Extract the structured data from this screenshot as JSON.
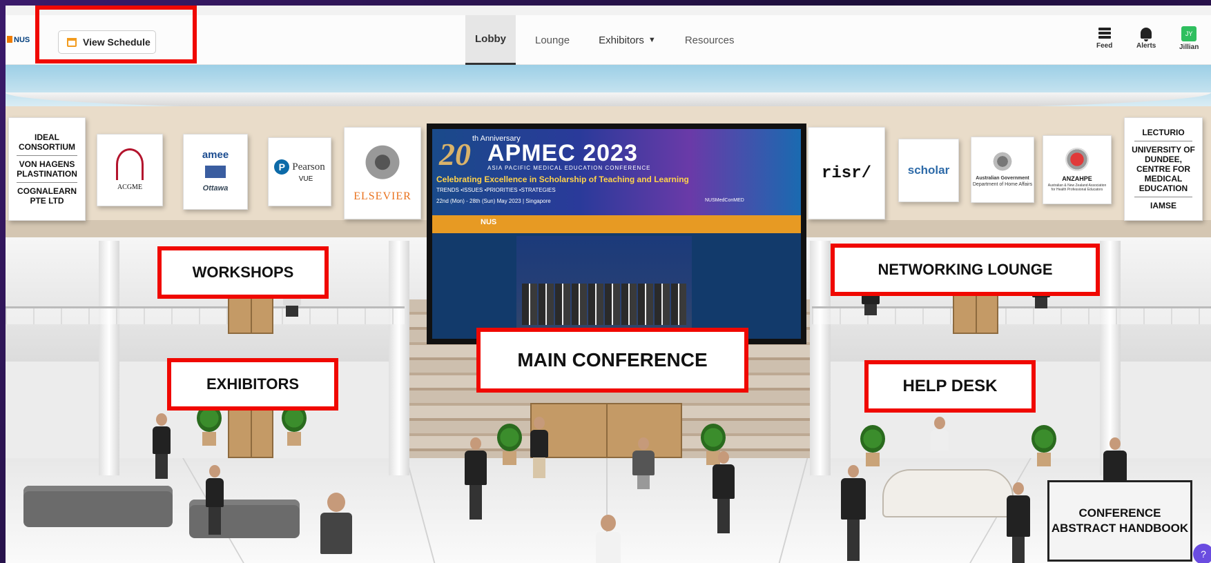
{
  "nav": {
    "logo": "NUS",
    "view_schedule": "View Schedule",
    "tabs": [
      {
        "label": "Lobby",
        "active": true
      },
      {
        "label": "Lounge"
      },
      {
        "label": "Exhibitors",
        "dropdown": true
      },
      {
        "label": "Resources"
      }
    ],
    "right": {
      "feed": "Feed",
      "alerts": "Alerts",
      "avatar_initials": "JY",
      "user": "Jillian"
    }
  },
  "sponsors_left": [
    {
      "lines": [
        "IDEAL CONSORTIUM",
        "VON HAGENS PLASTINATION",
        "COGNALEARN PTE LTD"
      ]
    },
    {
      "name": "ACGME"
    },
    {
      "name": "amee",
      "sub": "Ottawa"
    },
    {
      "name": "Pearson",
      "sub": "VUE"
    },
    {
      "name": "ELSEVIER"
    }
  ],
  "sponsors_right": [
    {
      "name": "risr/"
    },
    {
      "name": "scholar"
    },
    {
      "name": "Australian Government",
      "sub": "Department of Home Affairs"
    },
    {
      "name": "ANZAHPE",
      "sub": "Australian & New Zealand Association for Health Professional Educators"
    },
    {
      "lines": [
        "LECTURIO",
        "UNIVERSITY OF DUNDEE, CENTRE FOR MEDICAL EDUCATION",
        "IAMSE"
      ]
    }
  ],
  "screen": {
    "anniv": "th Anniversary",
    "num": "20",
    "title": "APMEC 2023",
    "subtitle": "ASIA PACIFIC MEDICAL EDUCATION CONFERENCE",
    "tagline": "Celebrating Excellence in Scholarship of Teaching and Learning",
    "trends": "TRENDS •ISSUES •PRIORITIES •STRATEGIES",
    "dates": "22nd (Mon) - 28th (Sun) May 2023  |  Singapore",
    "social": "NUSMedConMED",
    "strip_org": "NUS"
  },
  "zones": {
    "workshops": "WORKSHOPS",
    "networking": "NETWORKING LOUNGE",
    "exhibitors": "EXHIBITORS",
    "main": "MAIN CONFERENCE",
    "helpdesk": "HELP DESK",
    "handbook_l1": "CONFERENCE",
    "handbook_l2": "ABSTRACT HANDBOOK"
  },
  "help_icon": "?",
  "colors": {
    "highlight": "#f00800",
    "accent": "#f29b1e",
    "avatar": "#2fbf5f"
  }
}
